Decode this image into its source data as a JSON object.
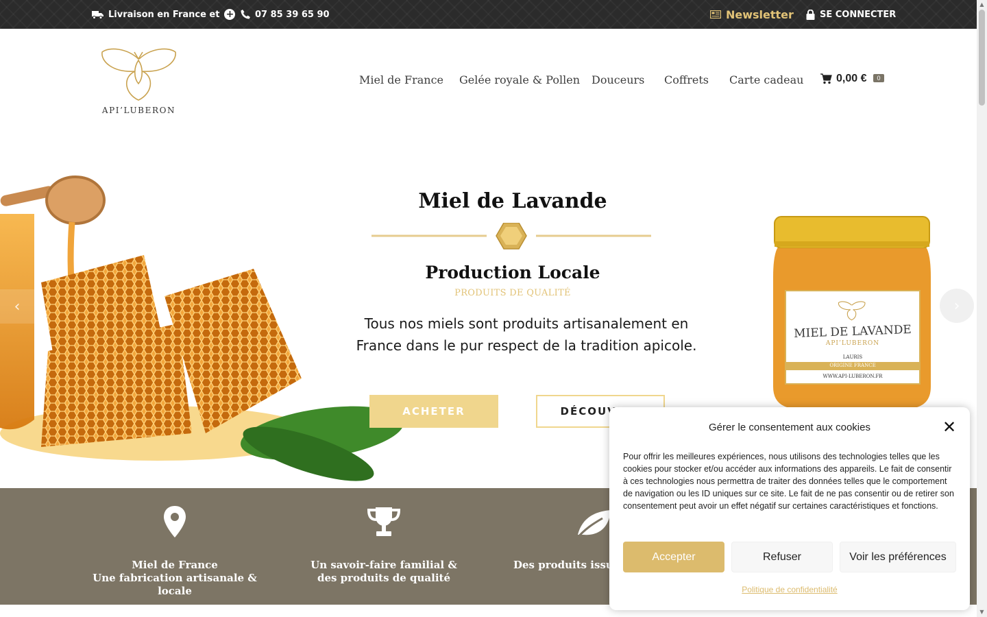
{
  "topbar": {
    "delivery_text": "Livraison en France et",
    "phone": "07 85 39 65 90",
    "newsletter_label": "Newsletter",
    "login_label": "SE CONNECTER"
  },
  "header": {
    "logo_text": "API’LUBERON",
    "nav": [
      "Miel de France",
      "Gelée royale & Pollen",
      "Douceurs",
      "Coffrets",
      "Carte cadeau"
    ],
    "cart": {
      "amount": "0,00 €",
      "count": "0"
    }
  },
  "hero": {
    "title": "Miel de Lavande",
    "subtitle": "Production Locale",
    "kicker": "PRODUITS DE QUALITÉ",
    "text": "Tous nos miels sont produits artisanalement en France dans le pur respect de la tradition apicole.",
    "buy_label": "ACHETER",
    "discover_label": "DÉCOUVRIR",
    "jar_label_title": "MIEL DE LAVANDE",
    "jar_label_brand": "API’LUBERON",
    "jar_label_place": "LAURIS",
    "jar_label_origin": "ORIGINE FRANCE",
    "jar_label_url": "WWW.API-LUBERON.FR"
  },
  "features": [
    {
      "text": "Miel de France\nUne fabrication artisanale & locale",
      "icon": "map-pin-icon"
    },
    {
      "text": "Un savoir-faire familial & des produits de qualité",
      "icon": "trophy-icon"
    },
    {
      "text": "Des produits issus",
      "icon": "leaf-icon"
    }
  ],
  "cookie": {
    "title": "Gérer le consentement aux cookies",
    "body": "Pour offrir les meilleures expériences, nous utilisons des technologies telles que les cookies pour stocker et/ou accéder aux informations des appareils. Le fait de consentir à ces technologies nous permettra de traiter des données telles que le comportement de navigation ou les ID uniques sur ce site. Le fait de ne pas consentir ou de retirer son consentement peut avoir un effet négatif sur certaines caractéristiques et fonctions.",
    "accept_label": "Accepter",
    "refuse_label": "Refuser",
    "prefs_label": "Voir les préférences",
    "policy_label": "Politique de confidentialité"
  },
  "colors": {
    "gold": "#e2c377",
    "button_gold": "#f0d68d",
    "accept_gold": "#dcbb6d",
    "band": "#7d7565",
    "topbar": "#2b2b2b"
  }
}
